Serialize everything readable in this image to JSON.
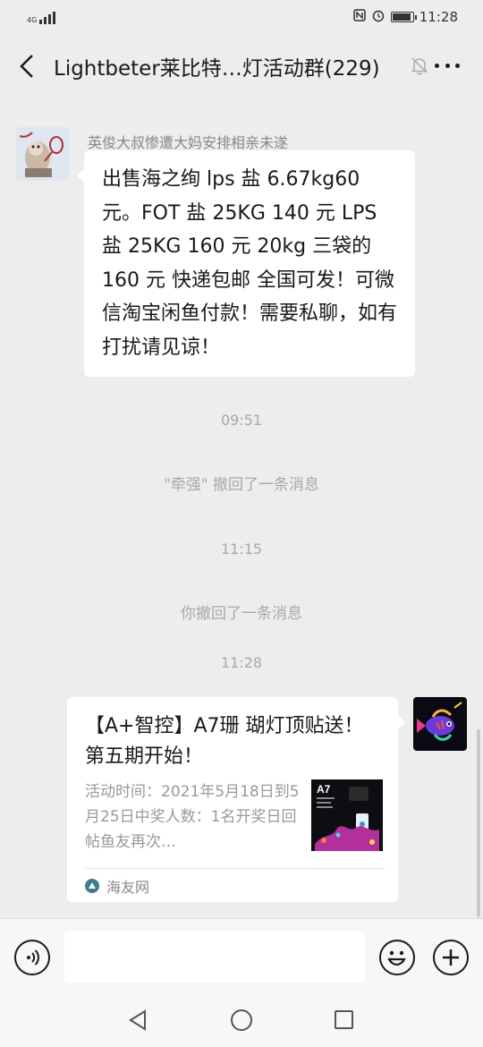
{
  "status_bar": {
    "network": "4G",
    "time": "11:28",
    "battery_percent": 90
  },
  "header": {
    "title": "Lightbeter莱比特…灯活动群(229)",
    "icons": [
      "back-icon",
      "mute-icon",
      "more-icon"
    ]
  },
  "messages": {
    "first": {
      "sender": "英俊大叔惨遭大妈安排相亲未遂",
      "text": "出售海之绚 lps 盐 6.67kg60 元。FOT 盐 25KG 140 元 LPS 盐 25KG 160 元  20kg 三袋的 160 元 快递包邮 全国可发！可微信淘宝闲鱼付款！需要私聊，如有打扰请见谅！"
    },
    "time1": "09:51",
    "recall1": "\"牵强\" 撤回了一条消息",
    "time2": "11:15",
    "recall2": "你撤回了一条消息",
    "time3": "11:28",
    "link_card": {
      "title": "【A+智控】A7珊 瑚灯顶贴送！第五期开始！",
      "desc": "活动时间：2021年5月18日到5月25日中奖人数：1名开奖日回帖鱼友再次…",
      "thumb_label": "A7",
      "source": "海友网"
    }
  },
  "input_bar": {
    "message_value": "",
    "icons": [
      "voice-icon",
      "emoji-icon",
      "plus-icon"
    ]
  },
  "nav_bar": {
    "icons": [
      "nav-back-icon",
      "nav-home-icon",
      "nav-recent-icon"
    ]
  }
}
